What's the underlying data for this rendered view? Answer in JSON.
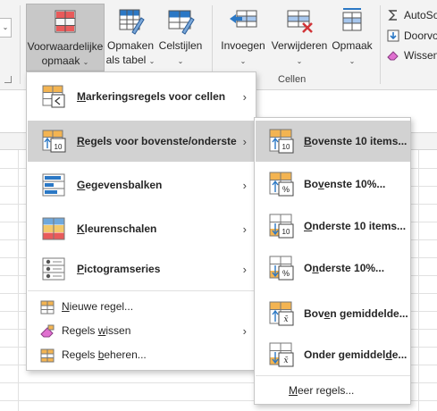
{
  "colors": {
    "ribbon_bg": "#f3f3f3",
    "highlight": "#d2d2d2",
    "accent_blue": "#2b78c5",
    "accent_red": "#d13438",
    "accent_orange": "#f3b452"
  },
  "ribbon": {
    "left_combo_glyph": "⌄",
    "buttons": [
      {
        "id": "voorwaardelijke",
        "line1": "Voorwaardelijke",
        "line2": "opmaak",
        "chevron": "⌄",
        "icon": "conditional-formatting-icon"
      },
      {
        "id": "tabel",
        "line1": "Opmaken",
        "line2": "als tabel",
        "chevron": "⌄",
        "icon": "format-as-table-icon"
      },
      {
        "id": "celstijlen",
        "line1": "Celstijlen",
        "line2": "",
        "chevron": "⌄",
        "icon": "cell-styles-icon"
      },
      {
        "id": "invoegen",
        "line1": "Invoegen",
        "line2": "",
        "chevron": "⌄",
        "icon": "insert-cells-icon"
      },
      {
        "id": "verwijderen",
        "line1": "Verwijderen",
        "line2": "",
        "chevron": "⌄",
        "icon": "delete-cells-icon"
      },
      {
        "id": "opmaak",
        "line1": "Opmaak",
        "line2": "",
        "chevron": "⌄",
        "icon": "format-cells-icon"
      }
    ],
    "group_cellen": "Cellen",
    "editing": [
      {
        "label": "AutoSo",
        "icon": "sigma-icon"
      },
      {
        "label": "Doorvo",
        "icon": "fill-down-icon"
      },
      {
        "label": "Wissen",
        "icon": "eraser-icon"
      }
    ]
  },
  "menu": {
    "items": [
      {
        "pre": "",
        "ul": "M",
        "post": "arkeringsregels voor cellen",
        "icon": "highlight-cells-rules-icon",
        "arrow": "›",
        "highlighted": false
      },
      {
        "pre": "",
        "ul": "R",
        "post": "egels voor bovenste/onderste",
        "icon": "top-bottom-rules-icon",
        "arrow": "›",
        "highlighted": true
      },
      {
        "pre": "",
        "ul": "G",
        "post": "egevensbalken",
        "icon": "data-bars-icon",
        "arrow": "›",
        "highlighted": false
      },
      {
        "pre": "",
        "ul": "K",
        "post": "leurenschalen",
        "icon": "color-scales-icon",
        "arrow": "›",
        "highlighted": false
      },
      {
        "pre": "",
        "ul": "P",
        "post": "ictogramseries",
        "icon": "icon-sets-icon",
        "arrow": "›",
        "highlighted": false
      }
    ],
    "small_items": [
      {
        "pre": "",
        "ul": "N",
        "post": "ieuwe regel...",
        "icon": "new-rule-icon",
        "arrow": ""
      },
      {
        "pre": "Regels ",
        "ul": "w",
        "post": "issen",
        "icon": "clear-rules-icon",
        "arrow": "›"
      },
      {
        "pre": "Regels ",
        "ul": "b",
        "post": "eheren...",
        "icon": "manage-rules-icon",
        "arrow": ""
      }
    ]
  },
  "submenu": {
    "items": [
      {
        "pre": "",
        "ul": "B",
        "post": "ovenste 10 items...",
        "icon": "top-10-items-icon",
        "badge": "10",
        "dir": "up",
        "highlighted": true
      },
      {
        "pre": "Bo",
        "ul": "v",
        "post": "enste 10%...",
        "icon": "top-10-percent-icon",
        "badge": "%",
        "dir": "up",
        "highlighted": false
      },
      {
        "pre": "",
        "ul": "O",
        "post": "nderste 10 items...",
        "icon": "bottom-10-items-icon",
        "badge": "10",
        "dir": "down",
        "highlighted": false
      },
      {
        "pre": "O",
        "ul": "n",
        "post": "derste 10%...",
        "icon": "bottom-10-percent-icon",
        "badge": "%",
        "dir": "down",
        "highlighted": false
      },
      {
        "pre": "Bov",
        "ul": "e",
        "post": "n gemiddelde...",
        "icon": "above-average-icon",
        "badge": "x̄",
        "dir": "up",
        "highlighted": false
      },
      {
        "pre": "Onder gemiddel",
        "ul": "d",
        "post": "e...",
        "icon": "below-average-icon",
        "badge": "x̄",
        "dir": "down",
        "highlighted": false
      }
    ],
    "more": {
      "pre": "",
      "ul": "M",
      "post": "eer regels..."
    }
  }
}
